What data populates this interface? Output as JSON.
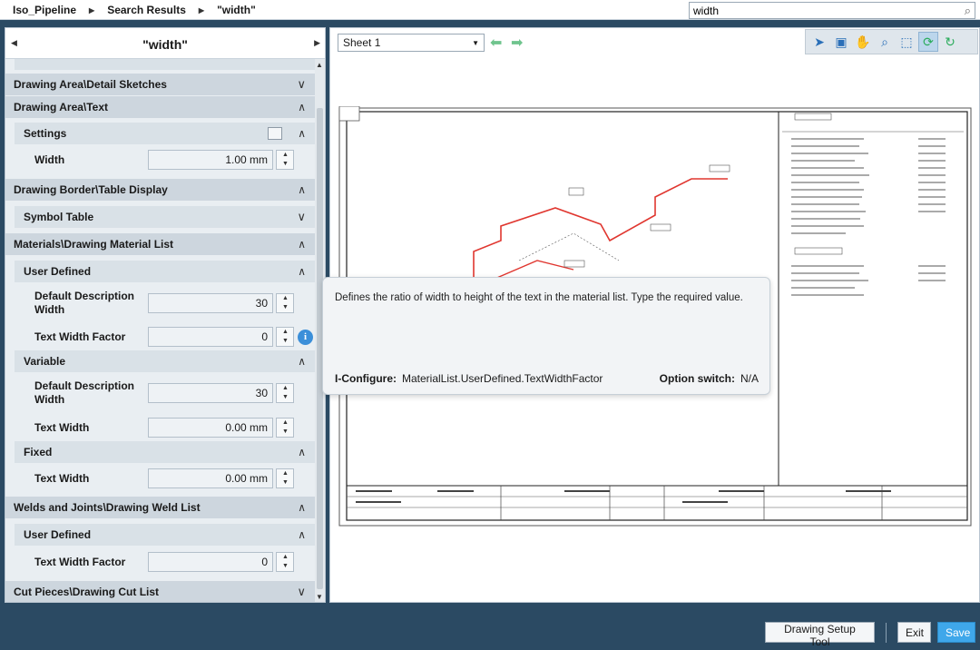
{
  "breadcrumb": [
    "Iso_Pipeline",
    "Search Results",
    "\"width\""
  ],
  "search": {
    "value": "width"
  },
  "panel": {
    "title": "\"width\"",
    "rows": [
      {
        "type": "section",
        "label": "Drawing Area\\Detail Sketches",
        "state": "collapsed"
      },
      {
        "type": "section",
        "label": "Drawing Area\\Text",
        "state": "expanded"
      },
      {
        "type": "subsection",
        "label": "Settings",
        "state": "expanded"
      },
      {
        "type": "property",
        "label": "Width",
        "value": "1.00 mm"
      },
      {
        "type": "section",
        "label": "Drawing Border\\Table Display",
        "state": "expanded"
      },
      {
        "type": "subsection",
        "label": "Symbol Table",
        "state": "collapsed"
      },
      {
        "type": "section",
        "label": "Materials\\Drawing Material List",
        "state": "expanded"
      },
      {
        "type": "subsection",
        "label": "User Defined",
        "state": "expanded"
      },
      {
        "type": "property",
        "label": "Default Description Width",
        "value": "30"
      },
      {
        "type": "property",
        "label": "Text Width Factor",
        "value": "0"
      },
      {
        "type": "subsection",
        "label": "Variable",
        "state": "expanded"
      },
      {
        "type": "property",
        "label": "Default Description Width",
        "value": "30"
      },
      {
        "type": "property",
        "label": "Text Width",
        "value": "0.00 mm"
      },
      {
        "type": "subsection",
        "label": "Fixed",
        "state": "expanded"
      },
      {
        "type": "property",
        "label": "Text Width",
        "value": "0.00 mm"
      },
      {
        "type": "section",
        "label": "Welds and Joints\\Drawing Weld List",
        "state": "expanded"
      },
      {
        "type": "subsection",
        "label": "User Defined",
        "state": "expanded"
      },
      {
        "type": "property",
        "label": "Text Width Factor",
        "value": "0"
      },
      {
        "type": "section",
        "label": "Cut Pieces\\Drawing Cut List",
        "state": "collapsed"
      }
    ]
  },
  "sheet": {
    "selected": "Sheet 1"
  },
  "tooltip": {
    "description": "Defines the ratio of width to height of the text in the material list. Type the required value.",
    "configure_label": "I-Configure:",
    "configure_value": "MaterialList.UserDefined.TextWidthFactor",
    "option_label": "Option switch:",
    "option_value": "N/A"
  },
  "footer": {
    "drawing_setup": "Drawing Setup Tool",
    "exit": "Exit",
    "save": "Save"
  },
  "colors": {
    "accent": "#3fa7ea",
    "background": "#2b4a63",
    "pipe": "#e0362f"
  }
}
